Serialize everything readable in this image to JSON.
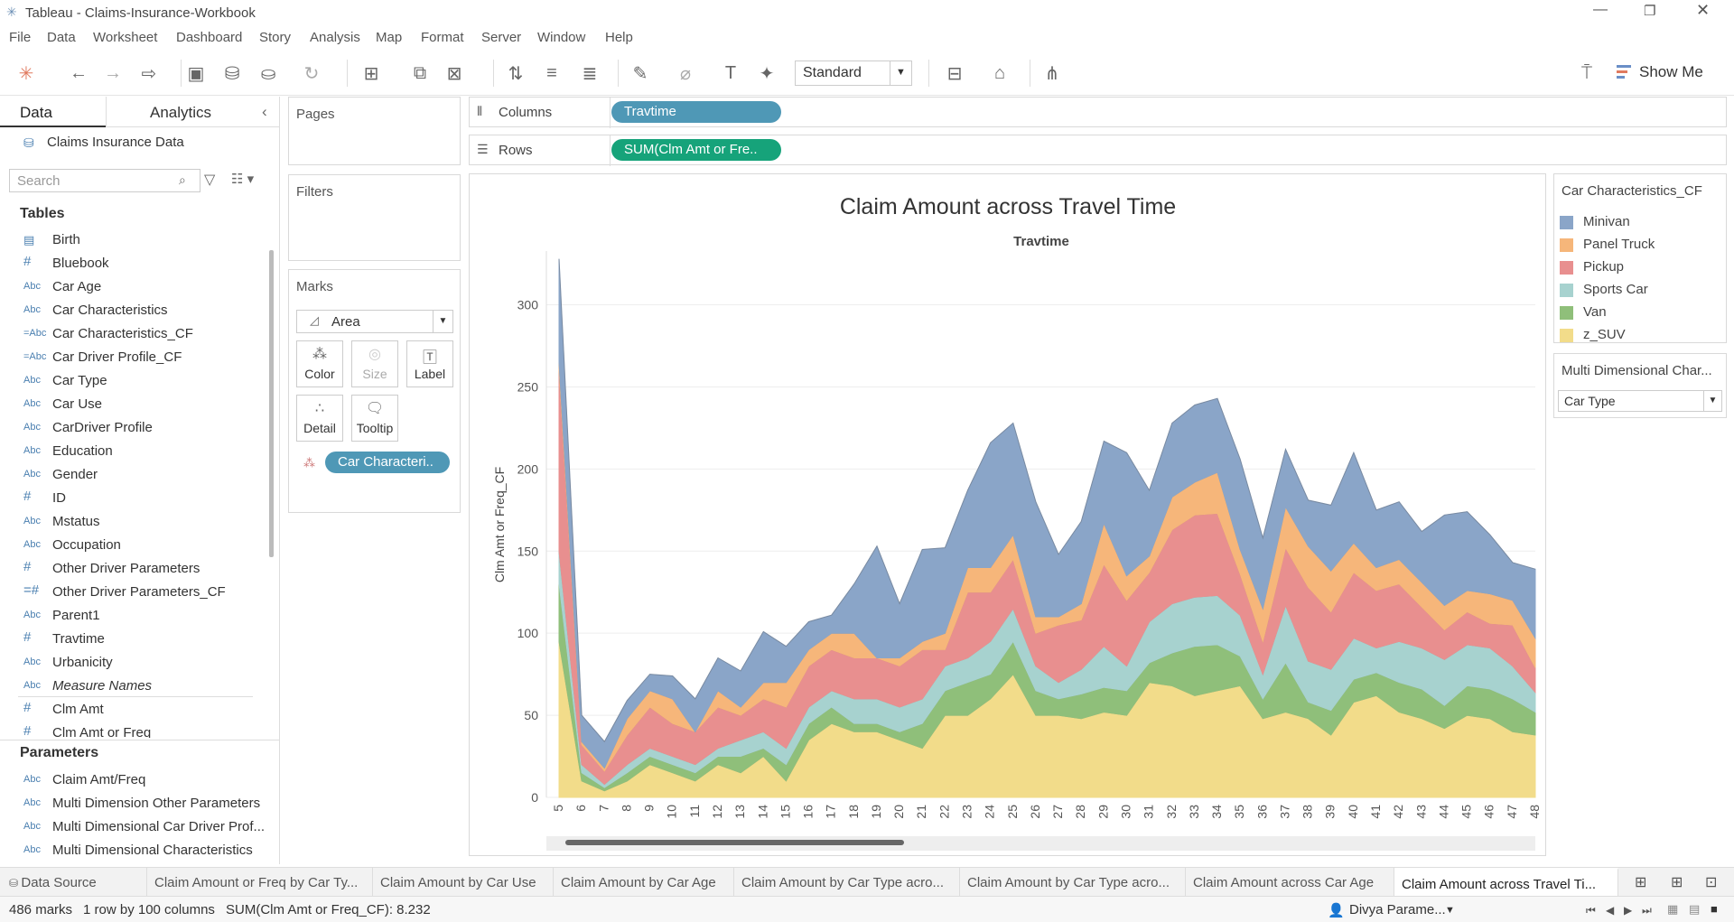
{
  "window": {
    "title": "Tableau - Claims-Insurance-Workbook"
  },
  "menu": [
    "File",
    "Data",
    "Worksheet",
    "Dashboard",
    "Story",
    "Analysis",
    "Map",
    "Format",
    "Server",
    "Window",
    "Help"
  ],
  "toolbar": {
    "fit_label": "Standard",
    "show_me_label": "Show Me"
  },
  "data_pane": {
    "tab_data": "Data",
    "tab_analytics": "Analytics",
    "source": "Claims Insurance Data",
    "search_placeholder": "Search",
    "tables_header": "Tables",
    "fields": [
      {
        "type": "Date",
        "name": "Birth"
      },
      {
        "type": "#",
        "name": "Bluebook"
      },
      {
        "type": "Abc",
        "name": "Car Age"
      },
      {
        "type": "Abc",
        "name": "Car Characteristics"
      },
      {
        "type": "=Abc",
        "name": "Car Characteristics_CF"
      },
      {
        "type": "=Abc",
        "name": "Car Driver Profile_CF"
      },
      {
        "type": "Abc",
        "name": "Car Type"
      },
      {
        "type": "Abc",
        "name": "Car Use"
      },
      {
        "type": "Abc",
        "name": "CarDriver Profile"
      },
      {
        "type": "Abc",
        "name": "Education"
      },
      {
        "type": "Abc",
        "name": "Gender"
      },
      {
        "type": "#",
        "name": "ID"
      },
      {
        "type": "Abc",
        "name": "Mstatus"
      },
      {
        "type": "Abc",
        "name": "Occupation"
      },
      {
        "type": "#",
        "name": "Other Driver Parameters"
      },
      {
        "type": "=#",
        "name": "Other Driver Parameters_CF"
      },
      {
        "type": "Abc",
        "name": "Parent1"
      },
      {
        "type": "#",
        "name": "Travtime"
      },
      {
        "type": "Abc",
        "name": "Urbanicity"
      },
      {
        "type": "Abc",
        "name": "Measure Names"
      },
      {
        "type": "#",
        "name": "Clm Amt"
      },
      {
        "type": "#",
        "name": "Clm Amt or Freq"
      }
    ],
    "parameters_header": "Parameters",
    "parameters": [
      {
        "type": "Abc",
        "name": "Claim Amt/Freq"
      },
      {
        "type": "Abc",
        "name": "Multi Dimension Other Parameters"
      },
      {
        "type": "Abc",
        "name": "Multi Dimensional Car Driver Prof..."
      },
      {
        "type": "Abc",
        "name": "Multi Dimensional Characteristics"
      }
    ]
  },
  "cards": {
    "pages": "Pages",
    "filters": "Filters",
    "marks": "Marks",
    "mark_type": "Area",
    "marks_buttons": [
      "Color",
      "Size",
      "Label",
      "Detail",
      "Tooltip"
    ],
    "color_pill": "Car Characteri.."
  },
  "shelves": {
    "columns_label": "Columns",
    "columns_pill": "Travtime",
    "rows_label": "Rows",
    "rows_pill": "SUM(Clm Amt or Fre.."
  },
  "legend": {
    "title": "Car Characteristics_CF",
    "items": [
      {
        "label": "Minivan",
        "color": "#8aa5c8"
      },
      {
        "label": "Panel Truck",
        "color": "#f6b67a"
      },
      {
        "label": "Pickup",
        "color": "#e88f8f"
      },
      {
        "label": "Sports Car",
        "color": "#a7d2cf"
      },
      {
        "label": "Van",
        "color": "#8fbf7a"
      },
      {
        "label": "z_SUV",
        "color": "#f2dc8a"
      }
    ]
  },
  "parameter_card": {
    "title": "Multi Dimensional Char...",
    "value": "Car Type"
  },
  "chart_data": {
    "type": "area",
    "title": "Claim Amount across Travel Time",
    "xlabel": "Travtime",
    "ylabel": "Clm Amt or Freq_CF",
    "ylim": [
      0,
      330
    ],
    "yticks": [
      0,
      50,
      100,
      150,
      200,
      250,
      300
    ],
    "stacked": true,
    "x": [
      5,
      6,
      7,
      8,
      9,
      10,
      11,
      12,
      13,
      14,
      15,
      16,
      17,
      18,
      19,
      20,
      21,
      22,
      23,
      24,
      25,
      26,
      27,
      28,
      29,
      30,
      31,
      32,
      33,
      34,
      35,
      36,
      37,
      38,
      39,
      40,
      41,
      42,
      43,
      44,
      45,
      46,
      47,
      48
    ],
    "series": [
      {
        "name": "z_SUV",
        "color": "#f2dc8a",
        "values": [
          95,
          10,
          4,
          10,
          20,
          15,
          10,
          20,
          15,
          25,
          10,
          35,
          45,
          40,
          40,
          35,
          30,
          50,
          50,
          60,
          75,
          50,
          50,
          48,
          52,
          50,
          70,
          68,
          62,
          65,
          68,
          48,
          52,
          48,
          38,
          58,
          62,
          52,
          48,
          42,
          50,
          48,
          40,
          38
        ]
      },
      {
        "name": "Van",
        "color": "#8fbf7a",
        "values": [
          35,
          5,
          2,
          5,
          5,
          5,
          5,
          5,
          10,
          5,
          10,
          10,
          10,
          5,
          5,
          5,
          15,
          15,
          20,
          15,
          20,
          15,
          10,
          15,
          15,
          15,
          12,
          20,
          30,
          28,
          18,
          12,
          30,
          10,
          15,
          14,
          14,
          18,
          18,
          14,
          18,
          18,
          20,
          14
        ]
      },
      {
        "name": "Sports Car",
        "color": "#a7d2cf",
        "values": [
          20,
          5,
          2,
          5,
          5,
          5,
          5,
          5,
          10,
          10,
          10,
          10,
          10,
          15,
          15,
          15,
          15,
          15,
          15,
          20,
          20,
          15,
          10,
          15,
          25,
          15,
          25,
          30,
          30,
          30,
          25,
          15,
          35,
          25,
          25,
          25,
          15,
          25,
          25,
          28,
          25,
          25,
          20,
          12
        ]
      },
      {
        "name": "Pickup",
        "color": "#e88f8f",
        "values": [
          110,
          12,
          8,
          18,
          25,
          20,
          20,
          25,
          15,
          20,
          25,
          25,
          25,
          25,
          25,
          25,
          30,
          10,
          40,
          30,
          30,
          20,
          35,
          30,
          50,
          40,
          30,
          45,
          50,
          50,
          25,
          20,
          35,
          45,
          35,
          40,
          35,
          35,
          25,
          18,
          20,
          15,
          25,
          15
        ]
      },
      {
        "name": "Panel Truck",
        "color": "#f6b67a",
        "values": [
          5,
          2,
          2,
          10,
          10,
          15,
          0,
          10,
          5,
          10,
          15,
          10,
          10,
          15,
          0,
          5,
          5,
          10,
          15,
          15,
          15,
          10,
          5,
          10,
          25,
          15,
          10,
          20,
          20,
          25,
          15,
          20,
          25,
          25,
          25,
          18,
          14,
          15,
          15,
          15,
          13,
          18,
          15,
          18
        ]
      },
      {
        "name": "Minivan",
        "color": "#8aa5c8",
        "values": [
          63,
          16,
          16,
          11,
          10,
          14,
          20,
          20,
          22,
          31,
          22,
          17,
          11,
          30,
          68,
          33,
          56,
          52,
          47,
          76,
          68,
          70,
          38,
          50,
          50,
          75,
          40,
          45,
          47,
          45,
          55,
          43,
          35,
          28,
          40,
          55,
          35,
          35,
          31,
          55,
          48,
          36,
          23,
          42
        ]
      }
    ]
  },
  "bottom_tabs": [
    "Data Source",
    "Claim Amount or Freq by Car Ty...",
    "Claim Amount by Car Use",
    "Claim Amount by Car Age",
    "Claim Amount by Car Type acro...",
    "Claim Amount by Car Type acro...",
    "Claim Amount across Car Age",
    "Claim Amount across Travel Ti..."
  ],
  "status": {
    "marks": "486 marks",
    "dims": "1 row by 100 columns",
    "sum": "SUM(Clm Amt or Freq_CF): 8.232",
    "user": "Divya Parame..."
  }
}
